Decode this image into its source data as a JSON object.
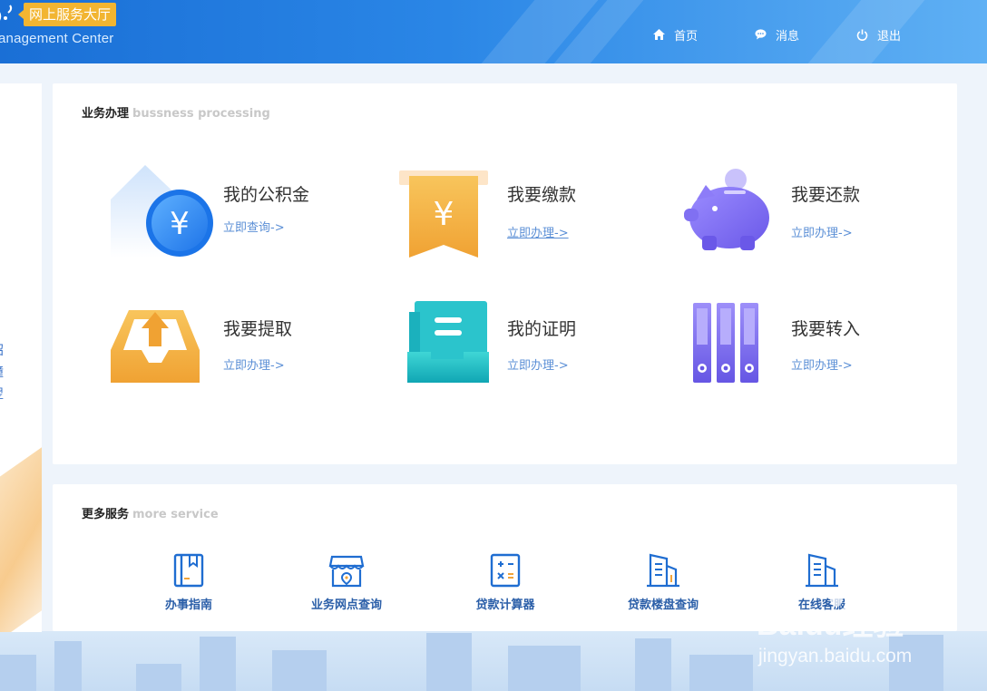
{
  "header": {
    "badge": "网上服务大厅",
    "subtitle": "anagement Center",
    "nav": [
      {
        "label": "首页",
        "icon": "home-icon"
      },
      {
        "label": "消息",
        "icon": "chat-icon"
      },
      {
        "label": "退出",
        "icon": "power-icon"
      }
    ]
  },
  "left_panel": {
    "glyphs": [
      "昭",
      "撞",
      "翌"
    ]
  },
  "business": {
    "title": "业务办理",
    "title_en": "bussness processing",
    "items": [
      {
        "name": "我的公积金",
        "link": "立即查询->",
        "icon": "house-coin-icon"
      },
      {
        "name": "我要缴款",
        "link": "立即办理->",
        "icon": "yuan-banner-icon"
      },
      {
        "name": "我要还款",
        "link": "立即办理->",
        "icon": "piggy-bank-icon"
      },
      {
        "name": "我要提取",
        "link": "立即办理->",
        "icon": "tray-upload-icon"
      },
      {
        "name": "我的证明",
        "link": "立即办理->",
        "icon": "certificate-tray-icon"
      },
      {
        "name": "我要转入",
        "link": "立即办理->",
        "icon": "binders-icon"
      }
    ]
  },
  "more": {
    "title": "更多服务",
    "title_en": "more service",
    "items": [
      {
        "label": "办事指南",
        "icon": "guide-book-icon"
      },
      {
        "label": "业务网点查询",
        "icon": "store-location-icon"
      },
      {
        "label": "贷款计算器",
        "icon": "calculator-icon"
      },
      {
        "label": "贷款楼盘查询",
        "icon": "building-icon"
      },
      {
        "label": "在线客服",
        "icon": "service-building-icon"
      }
    ]
  },
  "watermark": {
    "brand": "Baidu经验",
    "url": "jingyan.baidu.com"
  },
  "colors": {
    "header_blue": "#1a6fd6",
    "badge_yellow": "#f2b531",
    "link_blue": "#5b8fd6",
    "more_label_blue": "#2a5ea8"
  }
}
